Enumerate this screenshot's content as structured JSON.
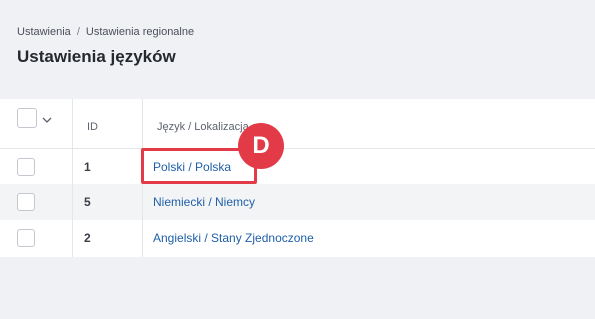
{
  "breadcrumb": {
    "items": [
      "Ustawienia",
      "Ustawienia regionalne"
    ],
    "separator": "/"
  },
  "page": {
    "title": "Ustawienia języków"
  },
  "table": {
    "columns": {
      "id": "ID",
      "language": "Język / Lokalizacja"
    },
    "rows": [
      {
        "id": "1",
        "language": "Polski / Polska"
      },
      {
        "id": "5",
        "language": "Niemiecki / Niemcy"
      },
      {
        "id": "2",
        "language": "Angielski / Stany Zjednoczone"
      }
    ]
  },
  "annotation": {
    "marker_label": "D",
    "color": "#e23b47"
  },
  "colors": {
    "link": "#1f5fa8",
    "background": "#f0f1f4"
  }
}
